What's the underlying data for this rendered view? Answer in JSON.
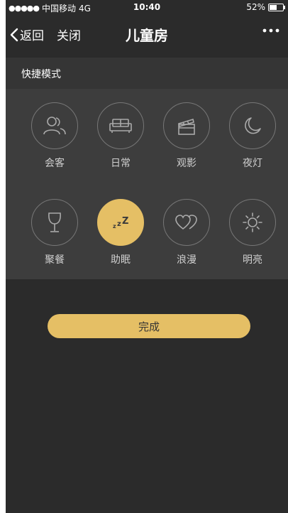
{
  "status_bar": {
    "carrier": "中国移动",
    "network": "4G",
    "time": "10:40",
    "battery": "52%"
  },
  "nav": {
    "back_label": "返回",
    "close_label": "关闭",
    "title": "儿童房",
    "more_icon": "more-icon"
  },
  "section": {
    "title": "快捷模式"
  },
  "modes": [
    {
      "label": "会客",
      "icon": "people-icon",
      "active": false
    },
    {
      "label": "日常",
      "icon": "sofa-icon",
      "active": false
    },
    {
      "label": "观影",
      "icon": "clapperboard-icon",
      "active": false
    },
    {
      "label": "夜灯",
      "icon": "moon-icon",
      "active": false
    },
    {
      "label": "聚餐",
      "icon": "wine-glass-icon",
      "active": false
    },
    {
      "label": "助眠",
      "icon": "sleep-zzz-icon",
      "active": true
    },
    {
      "label": "浪漫",
      "icon": "hearts-icon",
      "active": false
    },
    {
      "label": "明亮",
      "icon": "sun-icon",
      "active": false
    }
  ],
  "done": {
    "label": "完成"
  },
  "colors": {
    "accent": "#e5bf65",
    "background": "#2b2b2b",
    "panel": "#3d3d3d"
  }
}
